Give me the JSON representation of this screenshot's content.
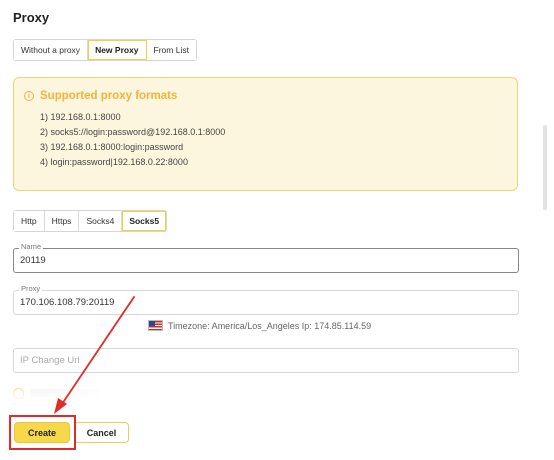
{
  "header": {
    "title": "Proxy"
  },
  "mode_tabs": [
    {
      "label": "Without a proxy",
      "active": false
    },
    {
      "label": "New Proxy",
      "active": true
    },
    {
      "label": "From List",
      "active": false
    }
  ],
  "info": {
    "title": "Supported proxy formats",
    "icon": "info-icon",
    "lines": [
      "1) 192.168.0.1:8000",
      "2) socks5://login:password@192.168.0.1:8000",
      "3) 192.168.0.1:8000:login:password",
      "4) login:password|192.168.0.22:8000"
    ]
  },
  "protocol_tabs": [
    {
      "label": "Http",
      "active": false
    },
    {
      "label": "Https",
      "active": false
    },
    {
      "label": "Socks4",
      "active": false
    },
    {
      "label": "Socks5",
      "active": true
    }
  ],
  "name_field": {
    "label": "Name",
    "value": "20119"
  },
  "proxy_field": {
    "label": "Proxy",
    "value": "170.106.108.79:20119"
  },
  "timezone": {
    "text": "Timezone: America/Los_Angeles Ip: 174.85.114.59",
    "flag": "us-flag-icon"
  },
  "ip_change": {
    "placeholder": "IP Change Url",
    "value": ""
  },
  "buttons": {
    "create": "Create",
    "cancel": "Cancel"
  },
  "colors": {
    "accent": "#f7d84a",
    "info_bg": "#fdf6df",
    "info_title": "#f0b43a",
    "annotation": "#e02b2b"
  }
}
